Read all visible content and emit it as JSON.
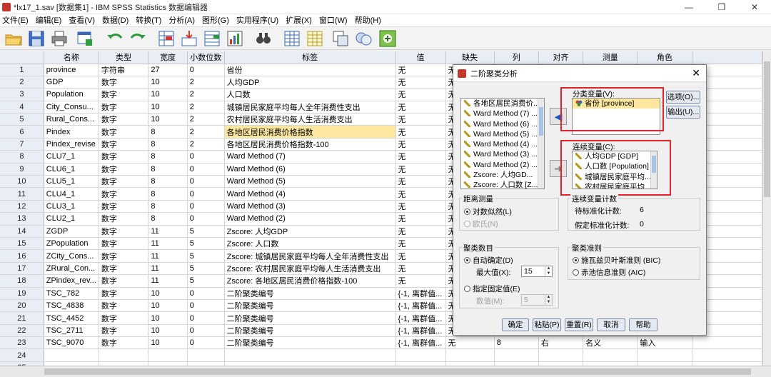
{
  "window": {
    "title": "*lx17_1.sav [数据集1] - IBM SPSS Statistics 数据编辑器",
    "controls": [
      "—",
      "❐",
      "✕"
    ]
  },
  "menu": [
    "文件(E)",
    "编辑(E)",
    "查看(V)",
    "数据(D)",
    "转换(T)",
    "分析(A)",
    "图形(G)",
    "实用程序(U)",
    "扩展(X)",
    "窗口(W)",
    "帮助(H)"
  ],
  "grid": {
    "headers": [
      "名称",
      "类型",
      "宽度",
      "小数位数",
      "标签",
      "值",
      "缺失",
      "列",
      "对齐",
      "测量",
      "角色"
    ],
    "rows": [
      [
        "1",
        "province",
        "字符串",
        "27",
        "0",
        "省份",
        "无",
        "无",
        "",
        "",
        "",
        ""
      ],
      [
        "2",
        "GDP",
        "数字",
        "10",
        "2",
        "人均GDP",
        "无",
        "无",
        "",
        "",
        "",
        ""
      ],
      [
        "3",
        "Population",
        "数字",
        "10",
        "2",
        "人口数",
        "无",
        "无",
        "",
        "",
        "",
        ""
      ],
      [
        "4",
        "City_Consu...",
        "数字",
        "10",
        "2",
        "城镇居民家庭平均每人全年消费性支出",
        "无",
        "无",
        "",
        "",
        "",
        ""
      ],
      [
        "5",
        "Rural_Cons...",
        "数字",
        "10",
        "2",
        "农村居民家庭平均每人生活消费支出",
        "无",
        "无",
        "",
        "",
        "",
        ""
      ],
      [
        "6",
        "Pindex",
        "数字",
        "8",
        "2",
        "各地区居民消费价格指数",
        "无",
        "无",
        "",
        "",
        "",
        ""
      ],
      [
        "7",
        "Pindex_revise",
        "数字",
        "8",
        "2",
        "各地区居民消费价格指数-100",
        "无",
        "无",
        "",
        "",
        "",
        ""
      ],
      [
        "8",
        "CLU7_1",
        "数字",
        "8",
        "0",
        "Ward Method  (7)",
        "无",
        "无",
        "",
        "",
        "",
        ""
      ],
      [
        "9",
        "CLU6_1",
        "数字",
        "8",
        "0",
        "Ward Method  (6)",
        "无",
        "无",
        "",
        "",
        "",
        ""
      ],
      [
        "10",
        "CLU5_1",
        "数字",
        "8",
        "0",
        "Ward Method  (5)",
        "无",
        "无",
        "",
        "",
        "",
        ""
      ],
      [
        "11",
        "CLU4_1",
        "数字",
        "8",
        "0",
        "Ward Method  (4)",
        "无",
        "无",
        "",
        "",
        "",
        ""
      ],
      [
        "12",
        "CLU3_1",
        "数字",
        "8",
        "0",
        "Ward Method  (3)",
        "无",
        "无",
        "",
        "",
        "",
        ""
      ],
      [
        "13",
        "CLU2_1",
        "数字",
        "8",
        "0",
        "Ward Method  (2)",
        "无",
        "无",
        "",
        "",
        "",
        ""
      ],
      [
        "14",
        "ZGDP",
        "数字",
        "11",
        "5",
        "Zscore:  人均GDP",
        "无",
        "无",
        "",
        "",
        "",
        ""
      ],
      [
        "15",
        "ZPopulation",
        "数字",
        "11",
        "5",
        "Zscore:  人口数",
        "无",
        "无",
        "",
        "",
        "",
        ""
      ],
      [
        "16",
        "ZCity_Cons...",
        "数字",
        "11",
        "5",
        "Zscore:  城镇居民家庭平均每人全年消费性支出",
        "无",
        "无",
        "",
        "",
        "",
        ""
      ],
      [
        "17",
        "ZRural_Con...",
        "数字",
        "11",
        "5",
        "Zscore:  农村居民家庭平均每人生活消费支出",
        "无",
        "无",
        "",
        "",
        "",
        ""
      ],
      [
        "18",
        "ZPindex_rev...",
        "数字",
        "11",
        "5",
        "Zscore:  各地区居民消费价格指数-100",
        "无",
        "无",
        "",
        "",
        "",
        ""
      ],
      [
        "19",
        "TSC_782",
        "数字",
        "10",
        "0",
        "二阶聚类编号",
        "{-1, 离群值...",
        "无",
        "",
        "",
        "",
        ""
      ],
      [
        "20",
        "TSC_4838",
        "数字",
        "10",
        "0",
        "二阶聚类编号",
        "{-1, 离群值...",
        "无",
        "",
        "",
        "",
        ""
      ],
      [
        "21",
        "TSC_4452",
        "数字",
        "10",
        "0",
        "二阶聚类编号",
        "{-1, 离群值...",
        "无",
        "",
        "",
        "",
        ""
      ],
      [
        "22",
        "TSC_2711",
        "数字",
        "10",
        "0",
        "二阶聚类编号",
        "{-1, 离群值...",
        "无",
        "",
        "",
        "",
        ""
      ],
      [
        "23",
        "TSC_9070",
        "数字",
        "10",
        "0",
        "二阶聚类编号",
        "{-1, 离群值...",
        "无",
        "8",
        "右",
        "名义",
        "输入"
      ],
      [
        "24",
        "",
        "",
        "",
        "",
        "",
        "",
        "",
        "",
        "",
        "",
        ""
      ],
      [
        "25",
        "",
        "",
        "",
        "",
        "",
        "",
        "",
        "",
        "",
        "",
        ""
      ]
    ]
  },
  "dialog": {
    "title": "二阶聚类分析",
    "source_vars": [
      "各地区居民消费价...",
      "Ward Method (7) ...",
      "Ward Method (6) ...",
      "Ward Method (5) ...",
      "Ward Method (4) ...",
      "Ward Method (3) ...",
      "Ward Method (2) ...",
      "Zscore: 人均GD...",
      "Zscore: 人口数 [Z..."
    ],
    "categorical_label": "分类变量(V):",
    "categorical_vars": [
      "省份 [province]"
    ],
    "continuous_label": "连续变量(C):",
    "continuous_vars": [
      "人均GDP [GDP]",
      "人口数 [Population]",
      "城镇居民家庭平均...",
      "农村居民家庭平均..."
    ],
    "options_button": "选项(O)...",
    "output_button": "输出(U)...",
    "distance_group": "距离测量",
    "distance_loglik": "对数似然(L)",
    "distance_euclid": "欧氏(N)",
    "count_group": "连续变量计数",
    "count_std_label": "待标准化计数:",
    "count_std_value": "6",
    "count_assumed_label": "假定标准化计数:",
    "count_assumed_value": "0",
    "clusters_group": "聚类数目",
    "auto_label": "自动确定(D)",
    "max_label": "最大值(X):",
    "max_value": "15",
    "fixed_label": "指定固定值(E)",
    "number_label": "数值(M):",
    "number_value": "5",
    "criterion_group": "聚类准则",
    "bic_label": "施瓦兹贝叶斯准则 (BIC)",
    "aic_label": "赤池信息准则 (AIC)",
    "buttons": {
      "ok": "确定",
      "paste": "粘贴(P)",
      "reset": "重置(R)",
      "cancel": "取消",
      "help": "帮助"
    }
  }
}
